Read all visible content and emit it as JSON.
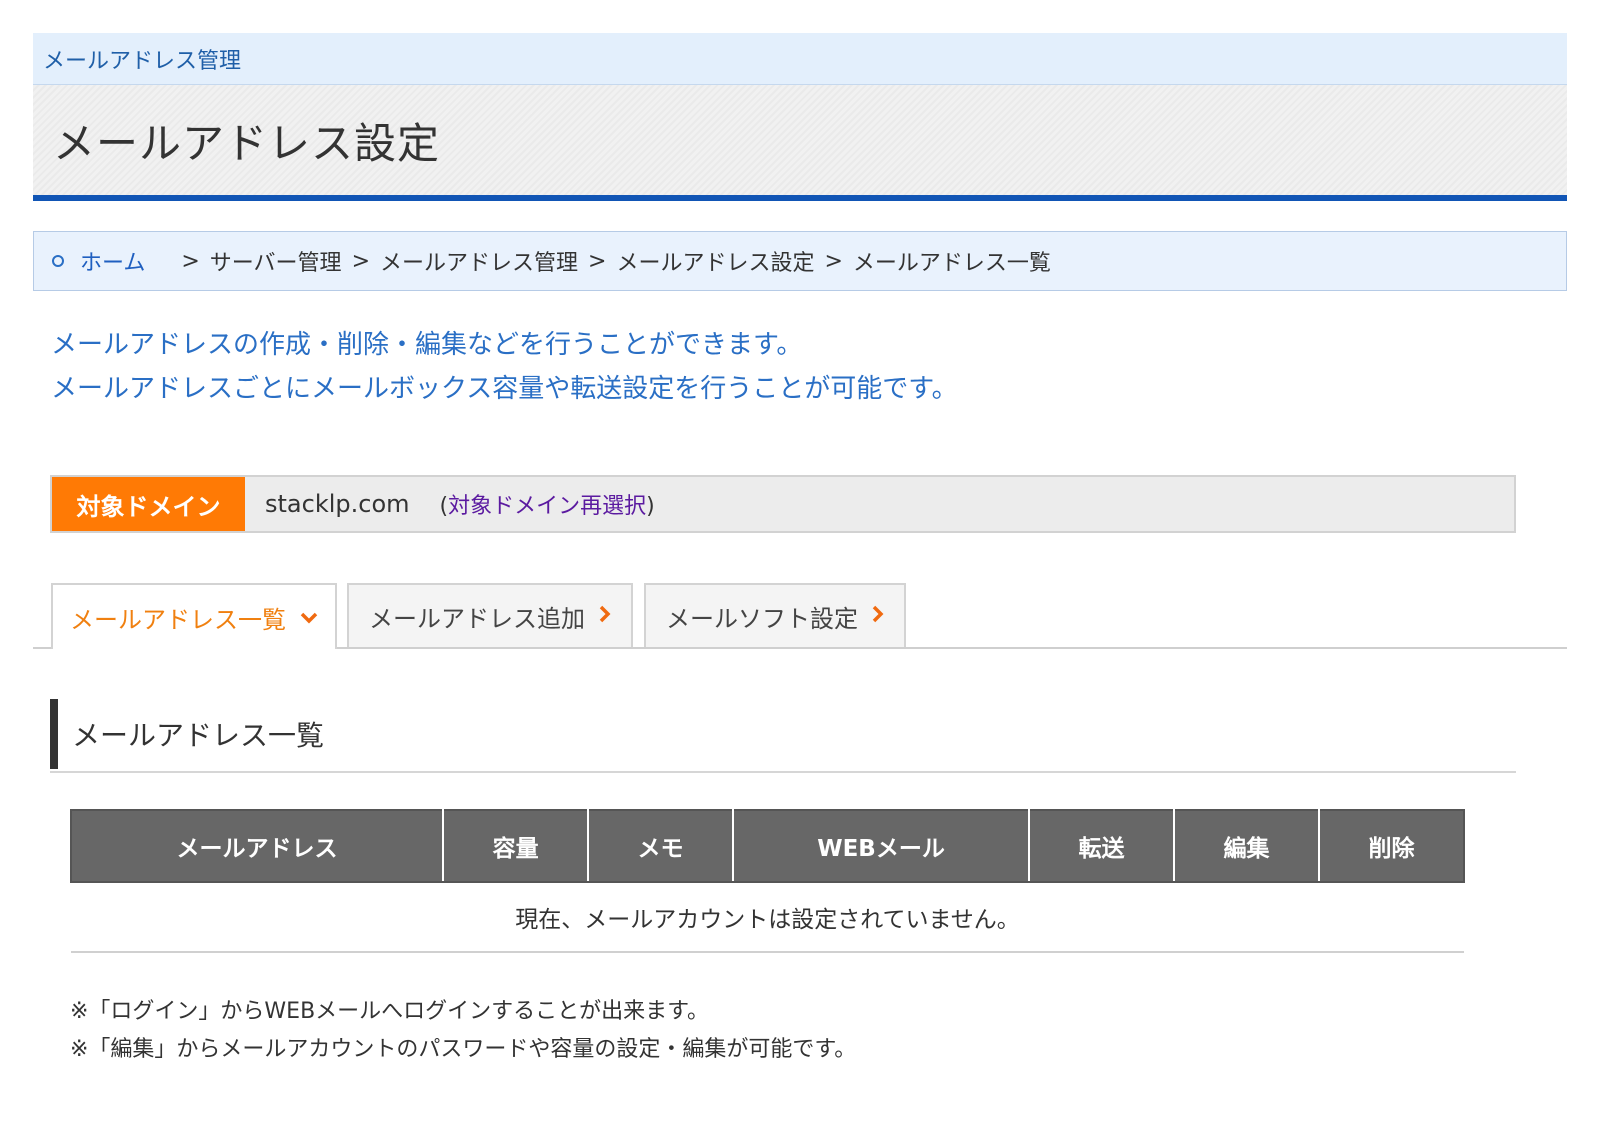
{
  "section_label": "メールアドレス管理",
  "page_title": "メールアドレス設定",
  "breadcrumb": {
    "home": "ホーム",
    "separator": ">",
    "items": [
      "サーバー管理",
      "メールアドレス管理",
      "メールアドレス設定",
      "メールアドレス一覧"
    ]
  },
  "description": {
    "line1": "メールアドレスの作成・削除・編集などを行うことができます。",
    "line2": "メールアドレスごとにメールボックス容量や転送設定を行うことが可能です。"
  },
  "domain": {
    "label": "対象ドメイン",
    "value": "stacklp.com",
    "reselect_open": "(",
    "reselect_link": "対象ドメイン再選択",
    "reselect_close": ")"
  },
  "tabs": [
    {
      "label": "メールアドレス一覧",
      "icon": "chevron-down-icon",
      "active": true
    },
    {
      "label": "メールアドレス追加",
      "icon": "chevron-right-icon",
      "active": false
    },
    {
      "label": "メールソフト設定",
      "icon": "chevron-right-icon",
      "active": false
    }
  ],
  "subsection_title": "メールアドレス一覧",
  "table": {
    "headers": [
      "メールアドレス",
      "容量",
      "メモ",
      "WEBメール",
      "転送",
      "編集",
      "削除"
    ],
    "empty_message": "現在、メールアカウントは設定されていません。"
  },
  "notes": [
    "※「ログイン」からWEBメールへログインすることが出来ます。",
    "※「編集」からメールアカウントのパスワードや容量の設定・編集が可能です。"
  ],
  "colors": {
    "accent_orange": "#ff7a05",
    "brand_blue": "#1155b5",
    "link_blue": "#2a6fc5",
    "header_gray": "#676767"
  }
}
